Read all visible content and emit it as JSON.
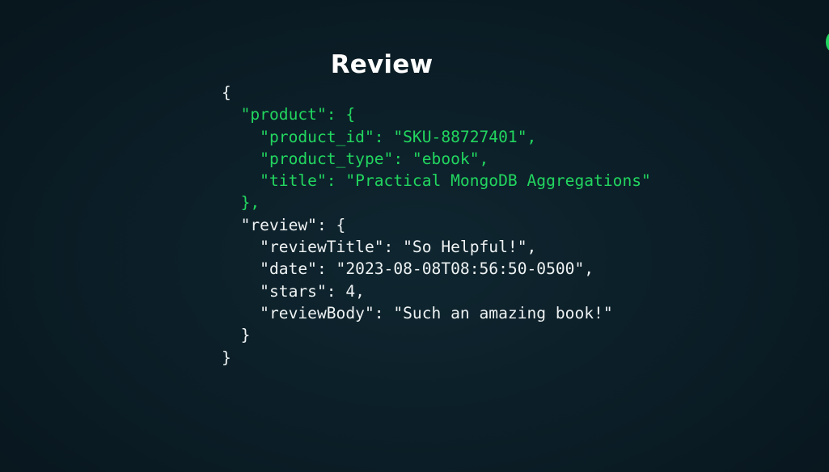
{
  "slide": {
    "title": "Review",
    "code_lines": [
      {
        "text": "{",
        "color": "white"
      },
      {
        "text": "  \"product\": {",
        "color": "green"
      },
      {
        "text": "    \"product_id\": \"SKU-88727401\",",
        "color": "green"
      },
      {
        "text": "    \"product_type\": \"ebook\",",
        "color": "green"
      },
      {
        "text": "    \"title\": \"Practical MongoDB Aggregations\"",
        "color": "green"
      },
      {
        "text": "  },",
        "color": "green"
      },
      {
        "text": "  \"review\": {",
        "color": "white"
      },
      {
        "text": "    \"reviewTitle\": \"So Helpful!\",",
        "color": "white"
      },
      {
        "text": "    \"date\": \"2023-08-08T08:56:50-0500\",",
        "color": "white"
      },
      {
        "text": "    \"stars\": 4,",
        "color": "white"
      },
      {
        "text": "    \"reviewBody\": \"Such an amazing book!\"",
        "color": "white"
      },
      {
        "text": "  }",
        "color": "white"
      },
      {
        "text": "}",
        "color": "white"
      }
    ]
  },
  "colors": {
    "background": "#0b1d26",
    "highlight_green": "#22d65f",
    "text_white": "#eef2f3"
  }
}
